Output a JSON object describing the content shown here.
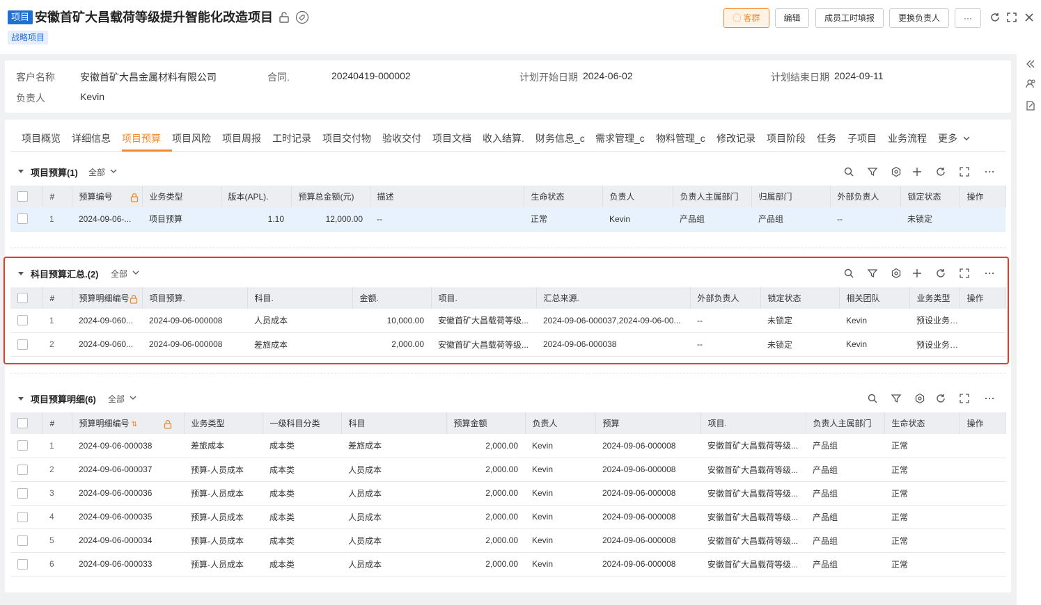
{
  "header": {
    "type_tag": "项目",
    "title": "安徽首矿大昌载荷等级提升智能化改造项目",
    "strategy_tag": "战略项目",
    "buttons": {
      "customer_group": "客群",
      "edit": "编辑",
      "member_hours": "成员工时填报",
      "change_owner": "更换负责人",
      "more": "···"
    }
  },
  "info": {
    "customer_label": "客户名称",
    "customer_value": "安徽首矿大昌金属材料有限公司",
    "contract_label": "合同.",
    "contract_value": "20240419-000002",
    "plan_start_label": "计划开始日期",
    "plan_start_value": "2024-06-02",
    "plan_end_label": "计划结束日期",
    "plan_end_value": "2024-09-11",
    "owner_label": "负责人",
    "owner_value": "Kevin"
  },
  "tabs": [
    "项目概览",
    "详细信息",
    "项目预算",
    "项目风险",
    "项目周报",
    "工时记录",
    "项目交付物",
    "验收交付",
    "项目文档",
    "收入结算.",
    "财务信息_c",
    "需求管理_c",
    "物料管理_c",
    "修改记录",
    "项目阶段",
    "任务",
    "子项目",
    "业务流程",
    "更多"
  ],
  "active_tab": "项目预算",
  "filter_all": "全部",
  "budget": {
    "title": "项目预算(1)",
    "columns": [
      "#",
      "预算编号",
      "业务类型",
      "版本(APL).",
      "预算总金额(元)",
      "描述",
      "生命状态",
      "负责人",
      "负责人主属部门",
      "归属部门",
      "外部负责人",
      "锁定状态",
      "操作"
    ],
    "rows": [
      {
        "idx": "1",
        "code": "2024-09-06-...",
        "type": "项目预算",
        "version": "1.10",
        "total": "12,000.00",
        "desc": "--",
        "status": "正常",
        "owner": "Kevin",
        "owner_dept": "产品组",
        "dept": "产品组",
        "ext_owner": "--",
        "lock": "未锁定"
      }
    ]
  },
  "summary": {
    "title": "科目预算汇总.(2)",
    "columns": [
      "#",
      "预算明细编号",
      "项目预算.",
      "科目.",
      "金额.",
      "项目.",
      "汇总来源.",
      "外部负责人",
      "锁定状态",
      "相关团队",
      "业务类型",
      "操作"
    ],
    "rows": [
      {
        "idx": "1",
        "code": "2024-09-060...",
        "budget": "2024-09-06-000008",
        "subject": "人员成本",
        "amount": "10,000.00",
        "project": "安徽首矿大昌载荷等级...",
        "source": "2024-09-06-000037,2024-09-06-00...",
        "ext_owner": "--",
        "lock": "未锁定",
        "team": "Kevin",
        "type": "预设业务类型"
      },
      {
        "idx": "2",
        "code": "2024-09-060...",
        "budget": "2024-09-06-000008",
        "subject": "差旅成本",
        "amount": "2,000.00",
        "project": "安徽首矿大昌载荷等级...",
        "source": "2024-09-06-000038",
        "ext_owner": "--",
        "lock": "未锁定",
        "team": "Kevin",
        "type": "预设业务类型"
      }
    ]
  },
  "detail": {
    "title": "项目预算明细(6)",
    "columns": [
      "#",
      "预算明细编号",
      "业务类型",
      "一级科目分类",
      "科目",
      "预算金额",
      "负责人",
      "预算",
      "项目.",
      "负责人主属部门",
      "生命状态",
      "操作"
    ],
    "rows": [
      {
        "idx": "1",
        "code": "2024-09-06-000038",
        "type": "差旅成本",
        "category": "成本类",
        "subject": "差旅成本",
        "amount": "2,000.00",
        "owner": "Kevin",
        "budget": "2024-09-06-000008",
        "project": "安徽首矿大昌载荷等级...",
        "dept": "产品组",
        "status": "正常"
      },
      {
        "idx": "2",
        "code": "2024-09-06-000037",
        "type": "预算-人员成本",
        "category": "成本类",
        "subject": "人员成本",
        "amount": "2,000.00",
        "owner": "Kevin",
        "budget": "2024-09-06-000008",
        "project": "安徽首矿大昌载荷等级...",
        "dept": "产品组",
        "status": "正常"
      },
      {
        "idx": "3",
        "code": "2024-09-06-000036",
        "type": "预算-人员成本",
        "category": "成本类",
        "subject": "人员成本",
        "amount": "2,000.00",
        "owner": "Kevin",
        "budget": "2024-09-06-000008",
        "project": "安徽首矿大昌载荷等级...",
        "dept": "产品组",
        "status": "正常"
      },
      {
        "idx": "4",
        "code": "2024-09-06-000035",
        "type": "预算-人员成本",
        "category": "成本类",
        "subject": "人员成本",
        "amount": "2,000.00",
        "owner": "Kevin",
        "budget": "2024-09-06-000008",
        "project": "安徽首矿大昌载荷等级...",
        "dept": "产品组",
        "status": "正常"
      },
      {
        "idx": "5",
        "code": "2024-09-06-000034",
        "type": "预算-人员成本",
        "category": "成本类",
        "subject": "人员成本",
        "amount": "2,000.00",
        "owner": "Kevin",
        "budget": "2024-09-06-000008",
        "project": "安徽首矿大昌载荷等级...",
        "dept": "产品组",
        "status": "正常"
      },
      {
        "idx": "6",
        "code": "2024-09-06-000033",
        "type": "预算-人员成本",
        "category": "成本类",
        "subject": "人员成本",
        "amount": "2,000.00",
        "owner": "Kevin",
        "budget": "2024-09-06-000008",
        "project": "安徽首矿大昌载荷等级...",
        "dept": "产品组",
        "status": "正常"
      }
    ]
  },
  "colors": {
    "accent": "#f08a2c",
    "link": "#1f6fd6",
    "highlight": "#e8392d"
  },
  "icons": [
    "lock-icon",
    "tag-icon",
    "refresh-icon",
    "expand-icon",
    "close-icon",
    "search-icon",
    "filter-icon",
    "settings-icon",
    "add-icon",
    "fullscreen-icon",
    "more-icon",
    "collapse-icon",
    "chevron-down-icon"
  ]
}
